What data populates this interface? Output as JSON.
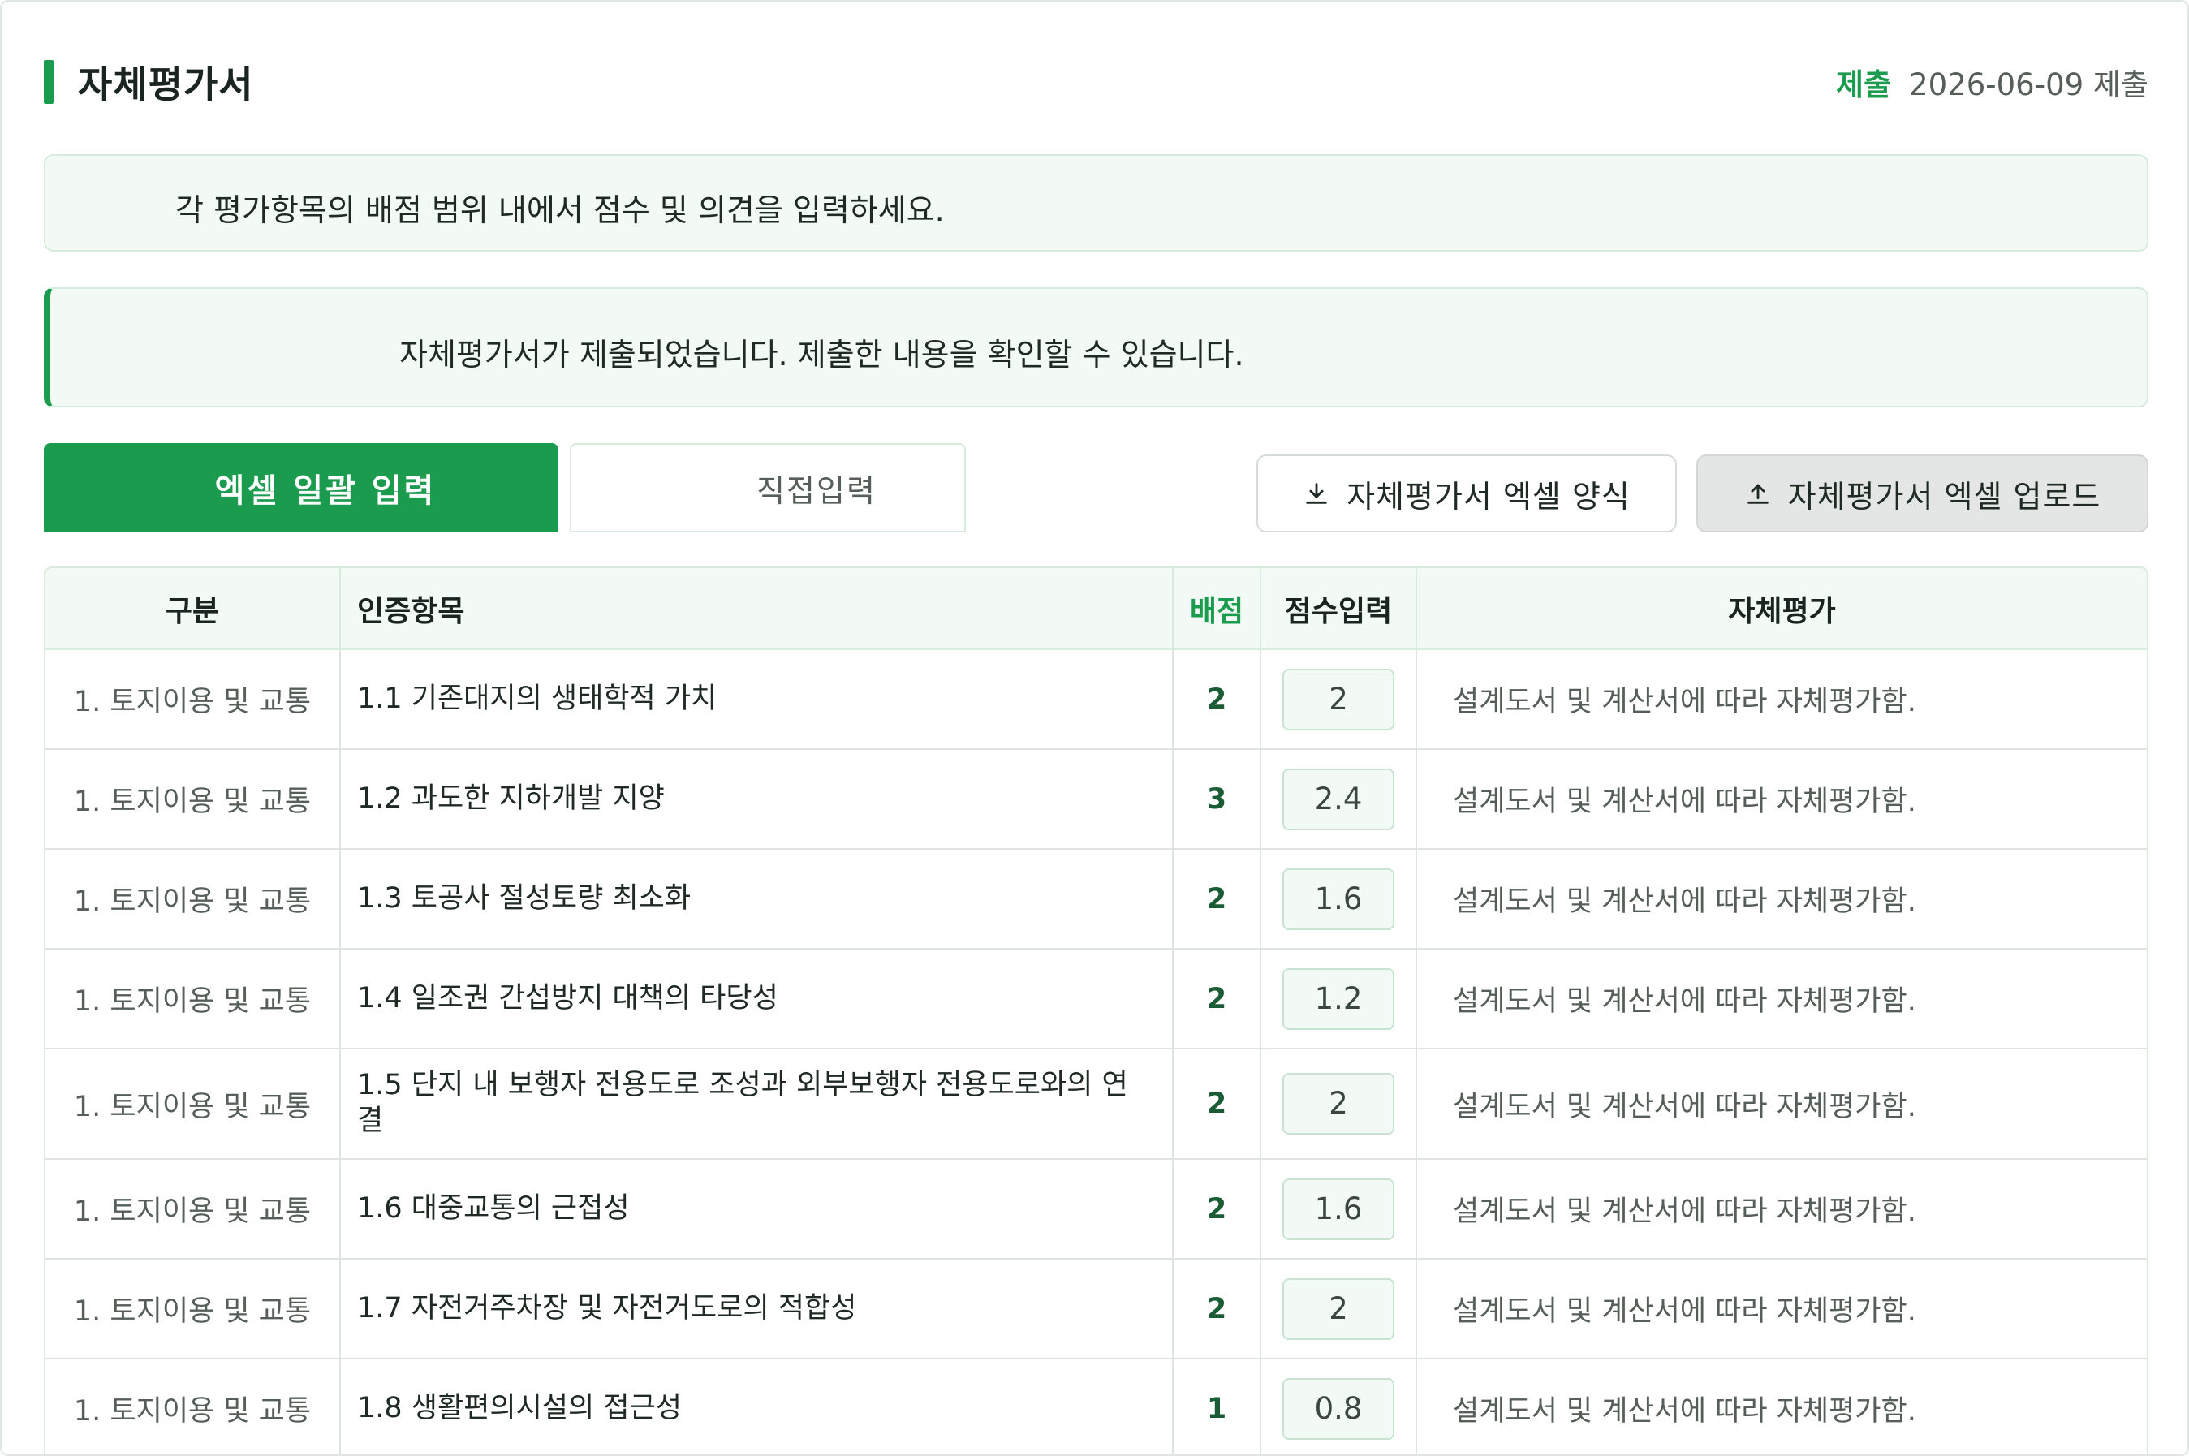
{
  "header": {
    "title": "자체평가서",
    "status_label": "제출",
    "status_date": "2026-06-09 제출"
  },
  "notices": {
    "guide": "각 평가항목의 배점 범위 내에서 점수 및 의견을 입력하세요.",
    "submitted": "자체평가서가 제출되었습니다. 제출한 내용을 확인할 수 있습니다."
  },
  "tabs": {
    "excel": "엑셀 일괄 입력",
    "direct": "직접입력"
  },
  "actions": {
    "template": "자체평가서 엑셀 양식",
    "upload": "자체평가서 엑셀 업로드"
  },
  "table": {
    "headers": {
      "category": "구분",
      "item": "인증항목",
      "points": "배점",
      "score": "점수입력",
      "evaluation": "자체평가"
    },
    "rows": [
      {
        "category": "1. 토지이용 및 교통",
        "item": "1.1 기존대지의 생태학적 가치",
        "points": "2",
        "score": "2",
        "evaluation": "설계도서 및 계산서에 따라 자체평가함."
      },
      {
        "category": "1. 토지이용 및 교통",
        "item": "1.2 과도한 지하개발 지양",
        "points": "3",
        "score": "2.4",
        "evaluation": "설계도서 및 계산서에 따라 자체평가함."
      },
      {
        "category": "1. 토지이용 및 교통",
        "item": "1.3 토공사 절성토량 최소화",
        "points": "2",
        "score": "1.6",
        "evaluation": "설계도서 및 계산서에 따라 자체평가함."
      },
      {
        "category": "1. 토지이용 및 교통",
        "item": "1.4 일조권 간섭방지 대책의 타당성",
        "points": "2",
        "score": "1.2",
        "evaluation": "설계도서 및 계산서에 따라 자체평가함."
      },
      {
        "category": "1. 토지이용 및 교통",
        "item": "1.5 단지 내 보행자 전용도로 조성과 외부보행자 전용도로와의 연결",
        "points": "2",
        "score": "2",
        "evaluation": "설계도서 및 계산서에 따라 자체평가함."
      },
      {
        "category": "1. 토지이용 및 교통",
        "item": "1.6 대중교통의 근접성",
        "points": "2",
        "score": "1.6",
        "evaluation": "설계도서 및 계산서에 따라 자체평가함."
      },
      {
        "category": "1. 토지이용 및 교통",
        "item": "1.7 자전거주차장 및 자전거도로의 적합성",
        "points": "2",
        "score": "2",
        "evaluation": "설계도서 및 계산서에 따라 자체평가함."
      },
      {
        "category": "1. 토지이용 및 교통",
        "item": "1.8 생활편의시설의 접근성",
        "points": "1",
        "score": "0.8",
        "evaluation": "설계도서 및 계산서에 따라 자체평가함."
      }
    ]
  }
}
